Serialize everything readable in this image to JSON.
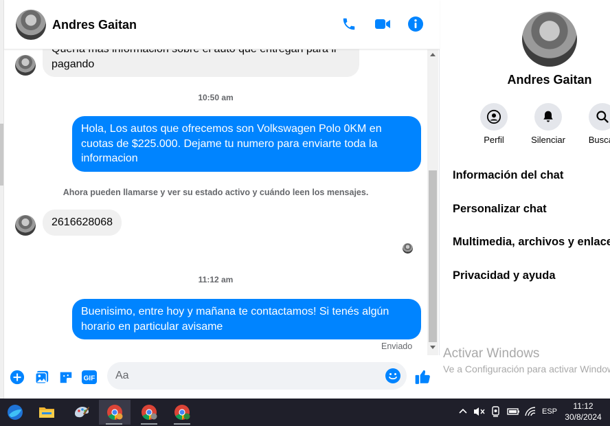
{
  "contact": {
    "name": "Andres Gaitan"
  },
  "header": {
    "icons": [
      "phone-icon",
      "video-camera-icon",
      "info-icon"
    ]
  },
  "messages": {
    "top_partial": {
      "line1": "Quería más información sobre el auto que entregan para ir",
      "line2": "pagando"
    },
    "ts1": "10:50 am",
    "out1": {
      "line1": "Hola, Los autos que ofrecemos son Volkswagen Polo 0KM en",
      "line2": "cuotas de $225.000. Dejame tu numero para enviarte toda la",
      "line3": "informacion"
    },
    "system": "Ahora pueden llamarse y ver su estado activo y cuándo leen los mensajes.",
    "in1": "2616628068",
    "ts2": "11:12 am",
    "out2": {
      "line1": "Buenisimo, entre hoy y mañana te contactamos! Si tenés algún",
      "line2": "horario en particular avisame"
    },
    "status": "Enviado"
  },
  "composer": {
    "placeholder": "Aa"
  },
  "sidebar": {
    "actions": [
      {
        "label": "Perfil"
      },
      {
        "label": "Silenciar"
      },
      {
        "label": "Buscar"
      }
    ],
    "menu": [
      {
        "label": "Información del chat"
      },
      {
        "label": "Personalizar chat"
      },
      {
        "label": "Multimedia, archivos y enlaces"
      },
      {
        "label": "Privacidad y ayuda"
      }
    ]
  },
  "watermark": {
    "line1": "Activar Windows",
    "line2": "Ve a Configuración para activar Windows."
  },
  "taskbar": {
    "lang": "ESP",
    "time": "11:12",
    "date": "30/8/2024"
  },
  "colors": {
    "accent": "#0084ff",
    "incoming_bubble": "#f0f0f0",
    "taskbar": "#1f1f2a"
  }
}
